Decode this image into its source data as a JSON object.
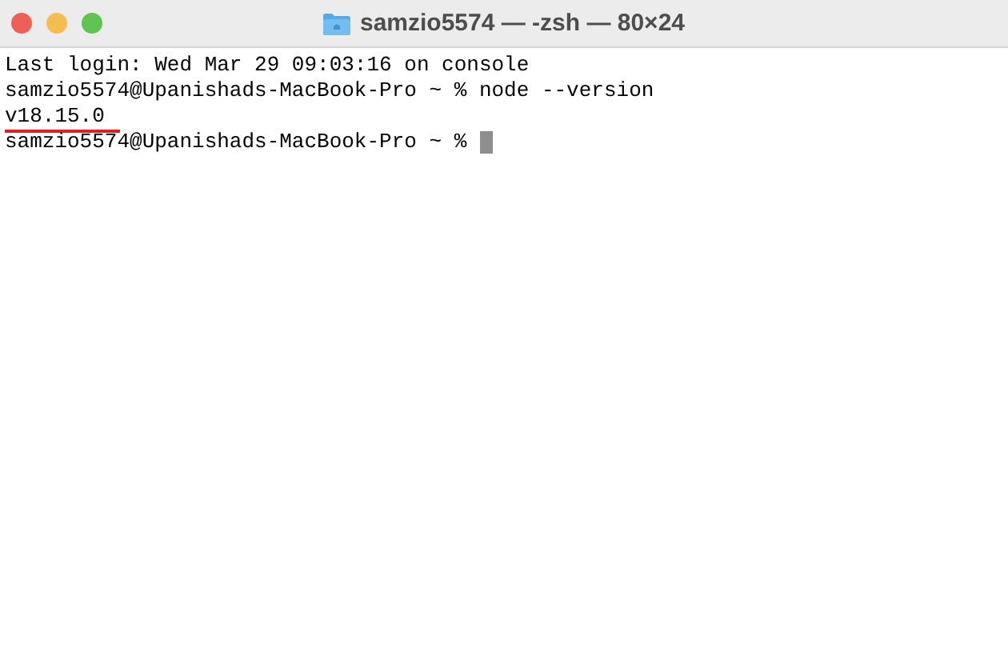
{
  "window": {
    "title": "samzio5574 — -zsh — 80×24"
  },
  "lines": [
    {
      "text": "Last login: Wed Mar 29 09:03:16 on console",
      "underlined": false,
      "cursor": false
    },
    {
      "text": "samzio5574@Upanishads-MacBook-Pro ~ % node --version",
      "underlined": false,
      "cursor": false
    },
    {
      "text": "v18.15.0",
      "underlined": true,
      "cursor": false
    },
    {
      "text": "samzio5574@Upanishads-MacBook-Pro ~ %",
      "underlined": false,
      "cursor": true
    }
  ]
}
